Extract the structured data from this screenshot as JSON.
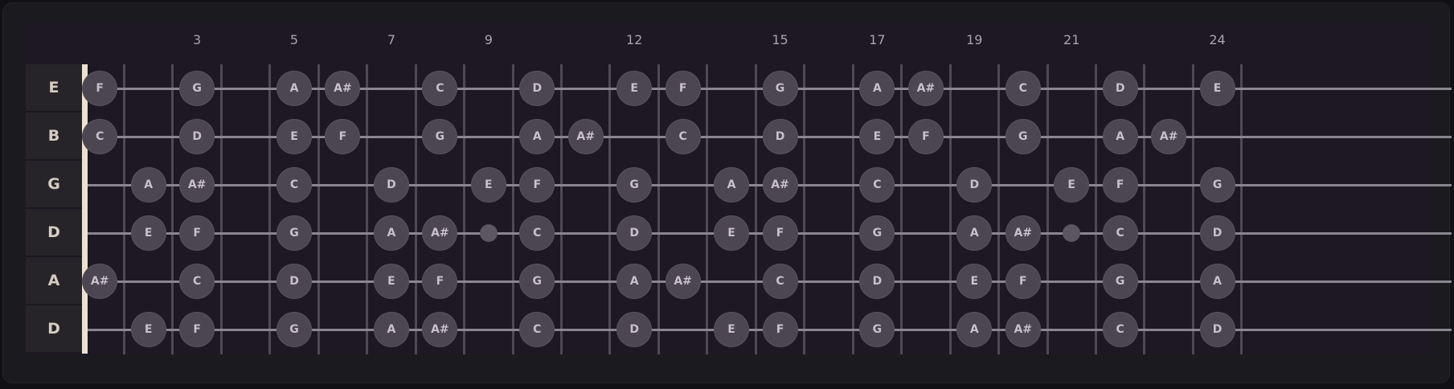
{
  "fret_numbers": [
    "3",
    "5",
    "7",
    "9",
    "12",
    "15",
    "17",
    "19",
    "21",
    "24"
  ],
  "strings": [
    {
      "label": "E",
      "notes": [
        {
          "fret": 1,
          "name": "F"
        },
        {
          "fret": 3,
          "name": "G"
        },
        {
          "fret": 5,
          "name": "A"
        },
        {
          "fret": 6,
          "name": "A#"
        },
        {
          "fret": 8,
          "name": "C"
        },
        {
          "fret": 10,
          "name": "D"
        },
        {
          "fret": 12,
          "name": "E"
        },
        {
          "fret": 13,
          "name": "F"
        },
        {
          "fret": 15,
          "name": "G"
        },
        {
          "fret": 17,
          "name": "A"
        },
        {
          "fret": 18,
          "name": "A#"
        },
        {
          "fret": 20,
          "name": "C"
        },
        {
          "fret": 22,
          "name": "D"
        },
        {
          "fret": 24,
          "name": "E"
        }
      ]
    },
    {
      "label": "B",
      "notes": [
        {
          "fret": 1,
          "name": "C"
        },
        {
          "fret": 3,
          "name": "D"
        },
        {
          "fret": 5,
          "name": "E"
        },
        {
          "fret": 6,
          "name": "F"
        },
        {
          "fret": 8,
          "name": "G"
        },
        {
          "fret": 10,
          "name": "A"
        },
        {
          "fret": 11,
          "name": "A#"
        },
        {
          "fret": 13,
          "name": "C"
        },
        {
          "fret": 15,
          "name": "D"
        },
        {
          "fret": 17,
          "name": "E"
        },
        {
          "fret": 18,
          "name": "F"
        },
        {
          "fret": 20,
          "name": "G"
        },
        {
          "fret": 22,
          "name": "A"
        },
        {
          "fret": 23,
          "name": "A#"
        }
      ]
    },
    {
      "label": "G",
      "notes": [
        {
          "fret": 2,
          "name": "A"
        },
        {
          "fret": 3,
          "name": "A#"
        },
        {
          "fret": 5,
          "name": "C"
        },
        {
          "fret": 7,
          "name": "D"
        },
        {
          "fret": 9,
          "name": "E"
        },
        {
          "fret": 10,
          "name": "F"
        },
        {
          "fret": 12,
          "name": "G"
        },
        {
          "fret": 14,
          "name": "A"
        },
        {
          "fret": 15,
          "name": "A#"
        },
        {
          "fret": 17,
          "name": "C"
        },
        {
          "fret": 19,
          "name": "D"
        },
        {
          "fret": 21,
          "name": "E"
        },
        {
          "fret": 22,
          "name": "F"
        },
        {
          "fret": 24,
          "name": "G"
        }
      ]
    },
    {
      "label": "D",
      "notes": [
        {
          "fret": 2,
          "name": "E"
        },
        {
          "fret": 3,
          "name": "F"
        },
        {
          "fret": 5,
          "name": "G"
        },
        {
          "fret": 7,
          "name": "A"
        },
        {
          "fret": 8,
          "name": "A#"
        },
        {
          "fret": 10,
          "name": "C"
        },
        {
          "fret": 12,
          "name": "D"
        },
        {
          "fret": 14,
          "name": "E"
        },
        {
          "fret": 15,
          "name": "F"
        },
        {
          "fret": 17,
          "name": "G"
        },
        {
          "fret": 19,
          "name": "A"
        },
        {
          "fret": 20,
          "name": "A#"
        },
        {
          "fret": 22,
          "name": "C"
        },
        {
          "fret": 24,
          "name": "D"
        }
      ]
    },
    {
      "label": "A",
      "notes": [
        {
          "fret": 1,
          "name": "A#"
        },
        {
          "fret": 3,
          "name": "C"
        },
        {
          "fret": 5,
          "name": "D"
        },
        {
          "fret": 7,
          "name": "E"
        },
        {
          "fret": 8,
          "name": "F"
        },
        {
          "fret": 10,
          "name": "G"
        },
        {
          "fret": 12,
          "name": "A"
        },
        {
          "fret": 13,
          "name": "A#"
        },
        {
          "fret": 15,
          "name": "C"
        },
        {
          "fret": 17,
          "name": "D"
        },
        {
          "fret": 19,
          "name": "E"
        },
        {
          "fret": 20,
          "name": "F"
        },
        {
          "fret": 22,
          "name": "G"
        },
        {
          "fret": 24,
          "name": "A"
        }
      ]
    },
    {
      "label": "D",
      "notes": [
        {
          "fret": 2,
          "name": "E"
        },
        {
          "fret": 3,
          "name": "F"
        },
        {
          "fret": 5,
          "name": "G"
        },
        {
          "fret": 7,
          "name": "A"
        },
        {
          "fret": 8,
          "name": "A#"
        },
        {
          "fret": 10,
          "name": "C"
        },
        {
          "fret": 12,
          "name": "D"
        },
        {
          "fret": 14,
          "name": "E"
        },
        {
          "fret": 15,
          "name": "F"
        },
        {
          "fret": 17,
          "name": "G"
        },
        {
          "fret": 19,
          "name": "A"
        },
        {
          "fret": 20,
          "name": "A#"
        },
        {
          "fret": 22,
          "name": "C"
        },
        {
          "fret": 24,
          "name": "D"
        }
      ]
    }
  ],
  "markers": [
    {
      "string": 4,
      "fret": 9
    },
    {
      "string": 4,
      "fret": 21
    }
  ]
}
